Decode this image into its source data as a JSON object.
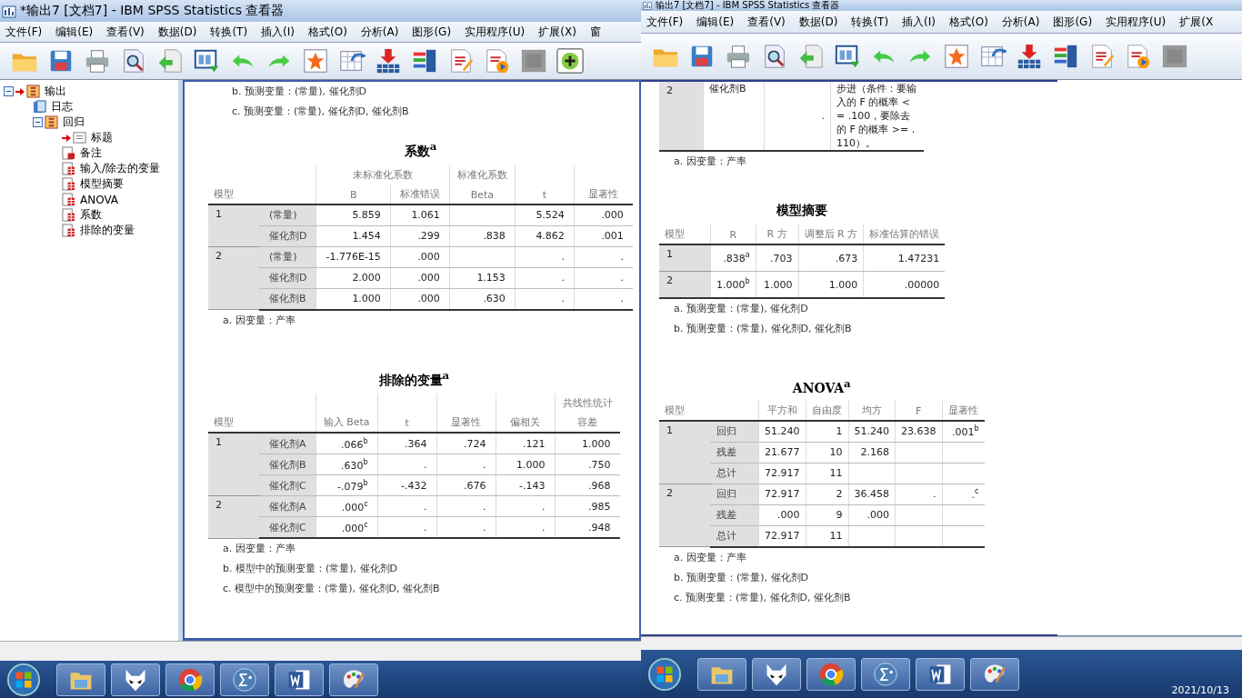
{
  "windows": [
    {
      "title": "*输出7 [文档7] - IBM SPSS Statistics 查看器",
      "menu": [
        "文件(F)",
        "编辑(E)",
        "查看(V)",
        "数据(D)",
        "转换(T)",
        "插入(I)",
        "格式(O)",
        "分析(A)",
        "图形(G)",
        "实用程序(U)",
        "扩展(X)",
        "窗"
      ],
      "outline": [
        {
          "label": "输出",
          "kind": "book",
          "current": true,
          "expanded": true,
          "children": [
            {
              "label": "日志",
              "kind": "log",
              "current": false
            },
            {
              "label": "回归",
              "kind": "book",
              "current": false,
              "expanded": true,
              "children": [
                {
                  "label": "标题",
                  "kind": "title",
                  "current": true
                },
                {
                  "label": "备注",
                  "kind": "notes",
                  "current": false
                },
                {
                  "label": "输入/除去的变量",
                  "kind": "table",
                  "current": false
                },
                {
                  "label": "模型摘要",
                  "kind": "table",
                  "current": false
                },
                {
                  "label": "ANOVA",
                  "kind": "table",
                  "current": false
                },
                {
                  "label": "系数",
                  "kind": "table",
                  "current": false
                },
                {
                  "label": "排除的变量",
                  "kind": "table",
                  "current": false
                }
              ]
            }
          ]
        }
      ],
      "content": [
        {
          "kind": "note",
          "text": "b. 预测变量：(常量), 催化剂D"
        },
        {
          "kind": "note",
          "text": "c. 预测变量：(常量), 催化剂D, 催化剂B"
        },
        {
          "kind": "table",
          "title": "系数$^{a}$",
          "model_header": "模型",
          "columns": [
            {
              "group": "未标准化系数",
              "columns": [
                "B",
                "标准错误"
              ]
            },
            {
              "group": "标准化系数",
              "columns": [
                "Beta"
              ]
            },
            "t",
            "显著性"
          ],
          "groups": [
            {
              "model": "1",
              "rows": [
                {
                  "label": "(常量)",
                  "cells": [
                    "5.859",
                    "1.061",
                    null,
                    "5.524",
                    ".000"
                  ]
                },
                {
                  "label": "催化剂D",
                  "cells": [
                    "1.454",
                    ".299",
                    ".838",
                    "4.862",
                    ".001"
                  ]
                }
              ]
            },
            {
              "model": "2",
              "rows": [
                {
                  "label": "(常量)",
                  "cells": [
                    "-1.776E-15",
                    ".000",
                    null,
                    ".",
                    "."
                  ]
                },
                {
                  "label": "催化剂D",
                  "cells": [
                    "2.000",
                    ".000",
                    "1.153",
                    ".",
                    "."
                  ]
                },
                {
                  "label": "催化剂B",
                  "cells": [
                    "1.000",
                    ".000",
                    ".630",
                    ".",
                    "."
                  ]
                }
              ]
            }
          ],
          "notes": [
            "a. 因变量：产率"
          ]
        },
        {
          "kind": "table",
          "title": "排除的变量$^{a}$",
          "model_header": "模型",
          "columns": [
            "输入 Beta",
            "t",
            "显著性",
            "偏相关",
            {
              "group": "共线性统计",
              "columns": [
                "容差"
              ]
            }
          ],
          "groups": [
            {
              "model": "1",
              "rows": [
                {
                  "label": "催化剂A",
                  "cells": [
                    ".066$^{b}$",
                    ".364",
                    ".724",
                    ".121",
                    "1.000"
                  ]
                },
                {
                  "label": "催化剂B",
                  "cells": [
                    ".630$^{b}$",
                    ".",
                    ".",
                    "1.000",
                    ".750"
                  ]
                },
                {
                  "label": "催化剂C",
                  "cells": [
                    "-.079$^{b}$",
                    "-.432",
                    ".676",
                    "-.143",
                    ".968"
                  ]
                }
              ]
            },
            {
              "model": "2",
              "rows": [
                {
                  "label": "催化剂A",
                  "cells": [
                    ".000$^{c}$",
                    ".",
                    ".",
                    ".",
                    ".985"
                  ]
                },
                {
                  "label": "催化剂C",
                  "cells": [
                    ".000$^{c}$",
                    ".",
                    ".",
                    ".",
                    ".948"
                  ]
                }
              ]
            }
          ],
          "notes": [
            "a. 因变量：产率",
            "b. 模型中的预测变量：(常量), 催化剂D",
            "c. 模型中的预测变量：(常量), 催化剂D, 催化剂B"
          ]
        }
      ]
    },
    {
      "title": "输出7 [文档7] - IBM SPSS Statistics 查看器",
      "menu": [
        "文件(F)",
        "编辑(E)",
        "查看(V)",
        "数据(D)",
        "转换(T)",
        "插入(I)",
        "格式(O)",
        "分析(A)",
        "图形(G)",
        "实用程序(U)",
        "扩展(X"
      ],
      "content": [
        {
          "kind": "table",
          "groups": [
            {
              "model": "2",
              "rows": [
                {
                  "cells": [
                    "催化剂B",
                    ".",
                    "步进（条件：要输入的 F 的概率 <= .100，要除去的 F 的概率 >= .110）。"
                  ]
                }
              ]
            }
          ],
          "notes": [
            "a. 因变量：产率"
          ]
        },
        {
          "kind": "table",
          "title": "模型摘要",
          "model_header": "模型",
          "columns": [
            "R",
            "R 方",
            "调整后 R 方",
            "标准估算的错误"
          ],
          "groups": [
            {
              "model": "1",
              "rows": [
                {
                  "cells": [
                    ".838$^{a}$",
                    ".703",
                    ".673",
                    "1.47231"
                  ]
                }
              ]
            },
            {
              "model": "2",
              "rows": [
                {
                  "cells": [
                    "1.000$^{b}$",
                    "1.000",
                    "1.000",
                    ".00000"
                  ]
                }
              ]
            }
          ],
          "notes": [
            "a. 预测变量：(常量), 催化剂D",
            "b. 预测变量：(常量), 催化剂D, 催化剂B"
          ]
        },
        {
          "kind": "table",
          "title": "ANOVA$^{a}$",
          "model_header": "模型",
          "columns": [
            "平方和",
            "自由度",
            "均方",
            "F",
            "显著性"
          ],
          "groups": [
            {
              "model": "1",
              "rows": [
                {
                  "label": "回归",
                  "cells": [
                    "51.240",
                    "1",
                    "51.240",
                    "23.638",
                    ".001$^{b}$"
                  ]
                },
                {
                  "label": "残差",
                  "cells": [
                    "21.677",
                    "10",
                    "2.168",
                    null,
                    null
                  ]
                },
                {
                  "label": "总计",
                  "cells": [
                    "72.917",
                    "11",
                    null,
                    null,
                    null
                  ]
                }
              ]
            },
            {
              "model": "2",
              "rows": [
                {
                  "label": "回归",
                  "cells": [
                    "72.917",
                    "2",
                    "36.458",
                    ".",
                    ".$^{c}$"
                  ]
                },
                {
                  "label": "残差",
                  "cells": [
                    ".000",
                    "9",
                    ".000",
                    null,
                    null
                  ]
                },
                {
                  "label": "总计",
                  "cells": [
                    "72.917",
                    "11",
                    null,
                    null,
                    null
                  ]
                }
              ]
            }
          ],
          "notes": [
            "a. 因变量：产率",
            "b. 预测变量：(常量), 催化剂D",
            "c. 预测变量：(常量), 催化剂D, 催化剂B"
          ]
        }
      ]
    }
  ],
  "clock": "2021/10/13"
}
